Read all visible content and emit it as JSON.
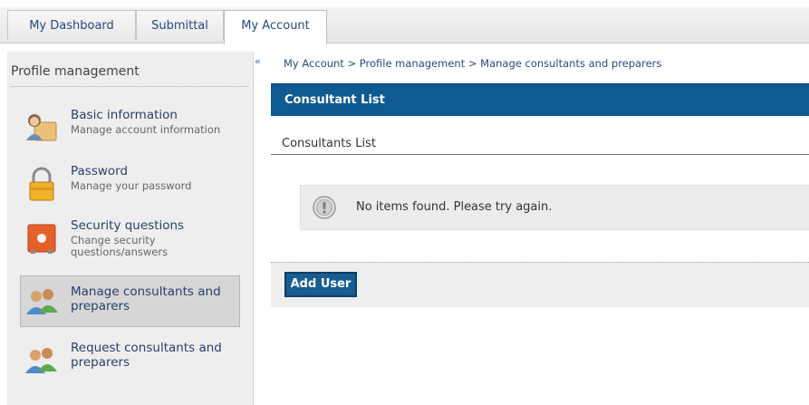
{
  "tabs": [
    {
      "label": "My Dashboard"
    },
    {
      "label": "Submittal"
    },
    {
      "label": "My Account"
    }
  ],
  "sidebar": {
    "title": "Profile management",
    "items": [
      {
        "label": "Basic information",
        "sub": "Manage account information",
        "icon": "user-card-icon"
      },
      {
        "label": "Password",
        "sub": "Manage your password",
        "icon": "lock-icon"
      },
      {
        "label": "Security questions",
        "sub": "Change security questions/answers",
        "icon": "safe-icon"
      },
      {
        "label": "Manage consultants and preparers",
        "sub": "",
        "icon": "users-icon",
        "active": true
      },
      {
        "label": "Request consultants and preparers",
        "sub": "",
        "icon": "users-icon"
      }
    ],
    "collapse_glyph": "«"
  },
  "main": {
    "breadcrumb": "My Account > Profile management > Manage consultants and preparers",
    "panel_title": "Consultant List",
    "section_title": "Consultants List",
    "notice": "No items found. Please try again.",
    "add_button": "Add User"
  },
  "colors": {
    "header_blue": "#0f5a92",
    "link_blue": "#2b4a7d",
    "button_blue": "#175d94"
  }
}
